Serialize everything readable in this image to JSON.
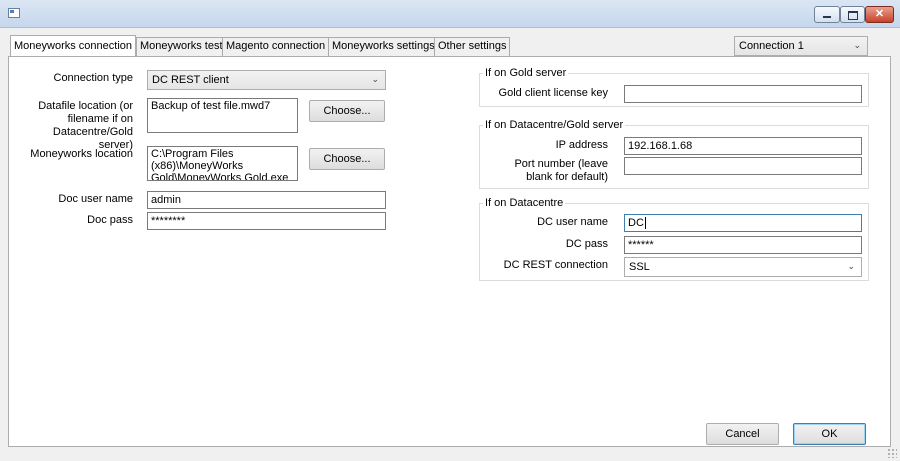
{
  "tabs": [
    {
      "label": "Moneyworks connection",
      "active": true
    },
    {
      "label": "Moneyworks test"
    },
    {
      "label": "Magento connection"
    },
    {
      "label": "Moneyworks settings"
    },
    {
      "label": "Other settings"
    }
  ],
  "connection_select": {
    "value": "Connection 1"
  },
  "left": {
    "connection_type_label": "Connection type",
    "connection_type_value": "DC REST client",
    "datafile_label": "Datafile location (or filename if on Datacentre/Gold server)",
    "datafile_value": "Backup of test file.mwd7",
    "moneyworks_location_label": "Moneyworks location",
    "moneyworks_location_value": "C:\\Program Files (x86)\\MoneyWorks Gold\\MoneyWorks Gold.exe",
    "choose_label": "Choose...",
    "doc_user_label": "Doc user name",
    "doc_user_value": "admin",
    "doc_pass_label": "Doc pass",
    "doc_pass_value": "********"
  },
  "gold": {
    "title": "If on Gold server",
    "license_label": "Gold client license key",
    "license_value": ""
  },
  "dc_gold": {
    "title": "If on Datacentre/Gold server",
    "ip_label": "IP address",
    "ip_value": "192.168.1.68",
    "port_label": "Port number (leave blank for default)",
    "port_value": ""
  },
  "dc": {
    "title": "If on Datacentre",
    "user_label": "DC user name",
    "user_value": "DC",
    "pass_label": "DC pass",
    "pass_value": "******",
    "rest_label": "DC REST connection",
    "rest_value": "SSL"
  },
  "footer": {
    "cancel_label": "Cancel",
    "ok_label": "OK"
  }
}
